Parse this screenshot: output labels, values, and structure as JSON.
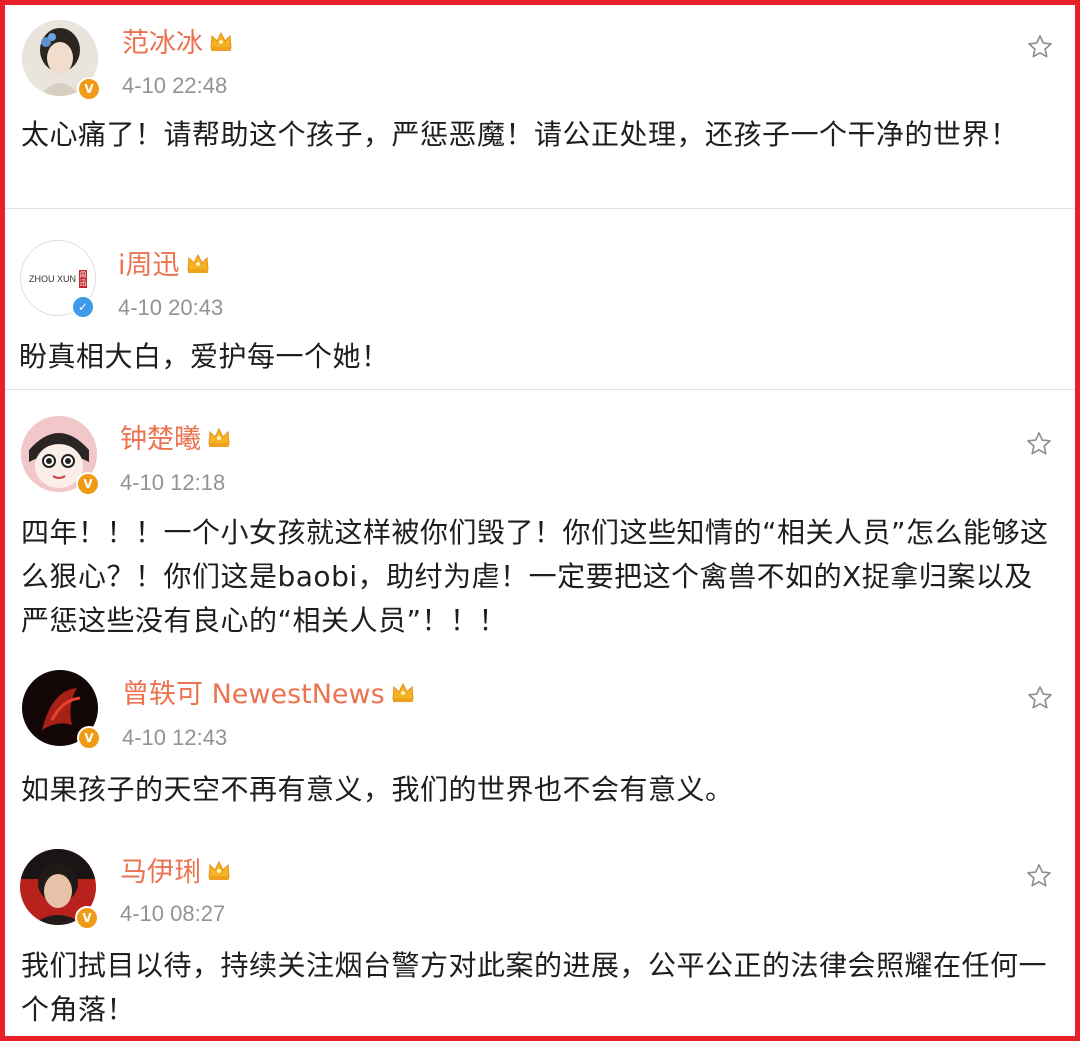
{
  "posts": [
    {
      "username": "范冰冰",
      "timestamp": "4-10 22:48",
      "verified": "orange",
      "content": "太心痛了！请帮助这个孩子，严惩恶魔！请公正处理，还孩子一个干净的世界！"
    },
    {
      "username": "i周迅",
      "timestamp": "4-10 20:43",
      "verified": "blue",
      "avatar_text": "ZHOU XUN",
      "avatar_seal": "周迅",
      "content": "盼真相大白，爱护每一个她！"
    },
    {
      "username": "钟楚曦",
      "timestamp": "4-10 12:18",
      "verified": "orange",
      "content": "四年！！！一个小女孩就这样被你们毁了！你们这些知情的“相关人员”怎么能够这么狠心？！你们这是baobi，助纣为虐！一定要把这个禽兽不如的X捉拿归案以及严惩这些没有良心的“相关人员”！！！"
    },
    {
      "username": "曾轶可 NewestNews",
      "timestamp": "4-10 12:43",
      "verified": "orange",
      "content": "如果孩子的天空不再有意义，我们的世界也不会有意义。"
    },
    {
      "username": "马伊琍",
      "timestamp": "4-10 08:27",
      "verified": "orange",
      "content": "我们拭目以待，持续关注烟台警方对此案的进展，公平公正的法律会照耀在任何一个角落！"
    }
  ],
  "colors": {
    "frame": "#e8202a",
    "username": "#eb7350",
    "timestamp": "#939393",
    "verified_orange": "#f09b15",
    "verified_blue": "#3e9bea"
  },
  "icons": {
    "favorite": "star-outline-icon",
    "vip": "crown-icon",
    "verified": "verified-badge-icon"
  }
}
